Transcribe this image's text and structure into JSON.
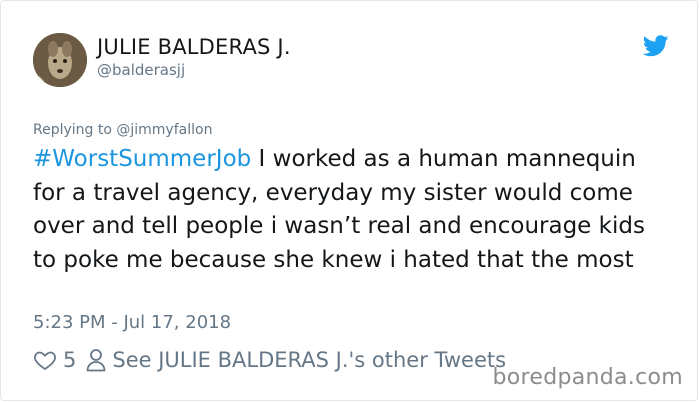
{
  "user": {
    "display_name": "JULIE BALDERAS J.",
    "handle": "@balderasjj",
    "avatar_icon": "profile-photo",
    "verified_logo": "twitter-bird-icon"
  },
  "tweet": {
    "reply_context": "Replying to @jimmyfallon",
    "hashtag": "#WorstSummerJob",
    "body": " I worked as a human mannequin for a travel agency, everyday my sister would come over and tell people i wasn’t real and encourage kids to poke me because she knew i hated that the most",
    "timestamp": "5:23 PM - Jul 17, 2018"
  },
  "actions": {
    "like_icon": "heart-icon",
    "like_count": "5",
    "profile_icon": "person-icon",
    "other_tweets_label": "See JULIE BALDERAS J.'s other Tweets"
  },
  "watermark": "boredpanda.com",
  "colors": {
    "link": "#1b95e0",
    "muted": "#657786",
    "text": "#14171a",
    "twitter_blue": "#1da1f2"
  }
}
